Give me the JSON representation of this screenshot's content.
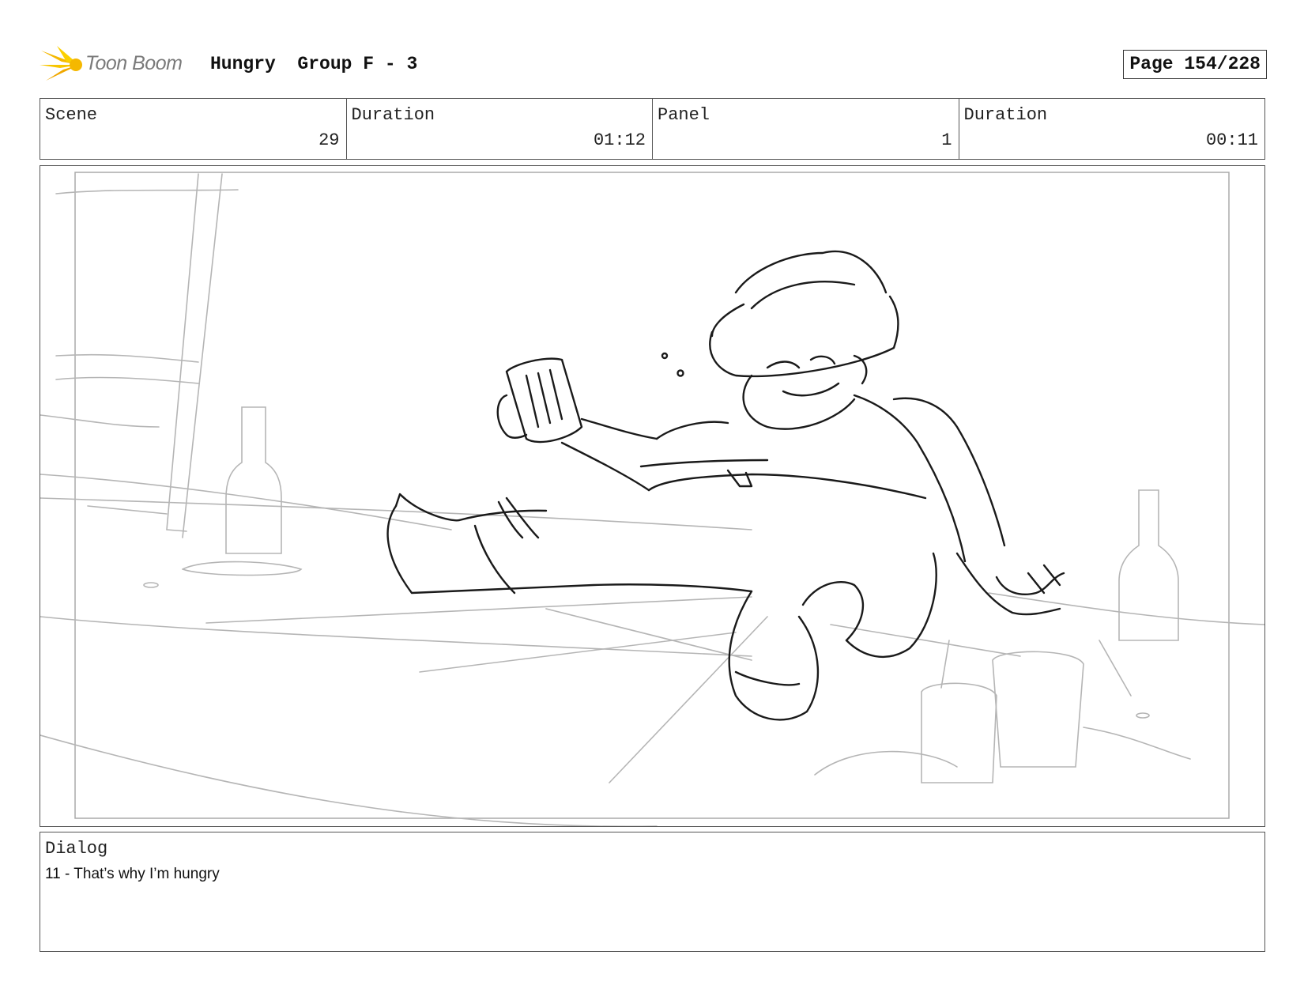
{
  "header": {
    "logo_text": "Toon Boom",
    "title": "Hungry  Group F - 3",
    "page": "Page 154/228"
  },
  "info": {
    "scene_label": "Scene",
    "scene_value": "29",
    "scene_duration_label": "Duration",
    "scene_duration_value": "01:12",
    "panel_label": "Panel",
    "panel_value": "1",
    "panel_duration_label": "Duration",
    "panel_duration_value": "00:11"
  },
  "dialog": {
    "label": "Dialog",
    "text": "11 - That’s why I’m hungry"
  },
  "colors": {
    "logo_accent": "#f5b800",
    "rough_sketch": "#b5b5b5",
    "clean_sketch": "#1a1a1a"
  }
}
